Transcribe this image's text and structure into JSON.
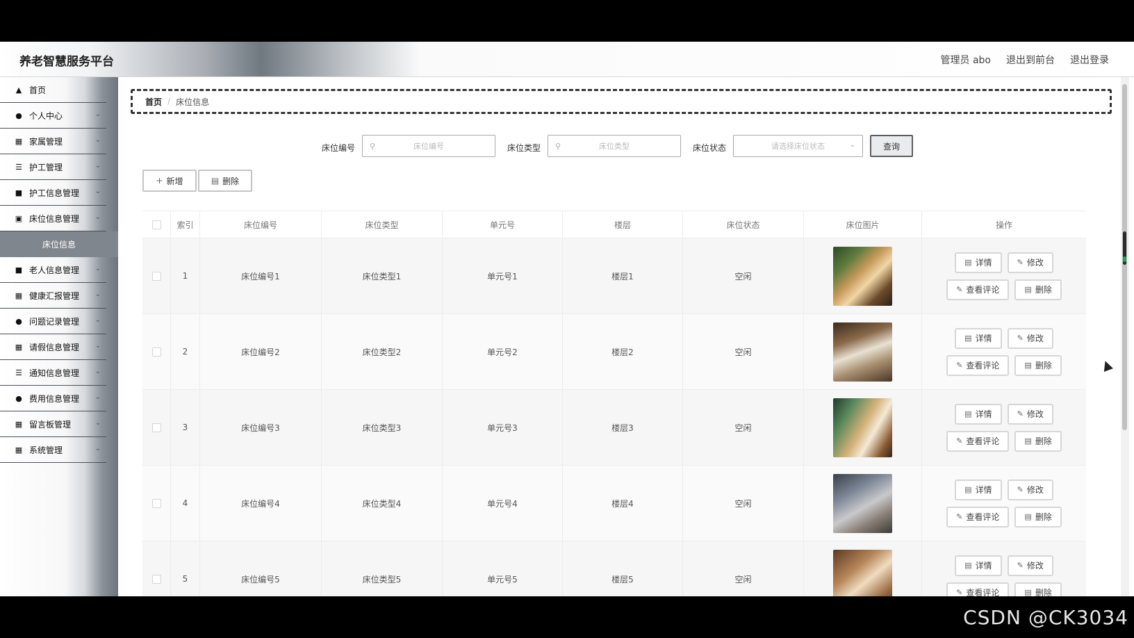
{
  "app": {
    "title": "养老智慧服务平台",
    "user": "管理员 abo",
    "back_front": "退出到前台",
    "logout": "退出登录"
  },
  "sidebar": {
    "items": [
      {
        "label": "首页",
        "icon": "home-icon"
      },
      {
        "label": "个人中心",
        "icon": "user-icon"
      },
      {
        "label": "家属管理",
        "icon": "calendar-icon"
      },
      {
        "label": "护工管理",
        "icon": "list-icon"
      },
      {
        "label": "护工信息管理",
        "icon": "monitor-icon"
      },
      {
        "label": "床位信息管理",
        "icon": "document-icon"
      },
      {
        "label": "老人信息管理",
        "icon": "monitor-icon"
      },
      {
        "label": "健康汇报管理",
        "icon": "grid-icon"
      },
      {
        "label": "问题记录管理",
        "icon": "user-icon"
      },
      {
        "label": "请假信息管理",
        "icon": "grid-icon"
      },
      {
        "label": "通知信息管理",
        "icon": "list-icon"
      },
      {
        "label": "费用信息管理",
        "icon": "user-icon"
      },
      {
        "label": "留言板管理",
        "icon": "grid-icon"
      },
      {
        "label": "系统管理",
        "icon": "grid-icon"
      }
    ],
    "active_sub": "床位信息"
  },
  "breadcrumb": {
    "home": "首页",
    "separator": "/",
    "current": "床位信息"
  },
  "search": {
    "bed_no_label": "床位编号",
    "bed_no_placeholder": "床位编号",
    "bed_type_label": "床位类型",
    "bed_type_placeholder": "床位类型",
    "bed_status_label": "床位状态",
    "bed_status_placeholder": "请选择床位状态",
    "query_button": "查询"
  },
  "toolbar": {
    "add_label": "新增",
    "delete_label": "删除"
  },
  "table": {
    "headers": [
      "索引",
      "床位编号",
      "床位类型",
      "单元号",
      "楼层",
      "床位状态",
      "床位图片",
      "操作"
    ],
    "rows": [
      {
        "index": "1",
        "bed_no": "床位编号1",
        "bed_type": "床位类型1",
        "unit": "单元号1",
        "floor": "楼层1",
        "status": "空闲"
      },
      {
        "index": "2",
        "bed_no": "床位编号2",
        "bed_type": "床位类型2",
        "unit": "单元号2",
        "floor": "楼层2",
        "status": "空闲"
      },
      {
        "index": "3",
        "bed_no": "床位编号3",
        "bed_type": "床位类型3",
        "unit": "单元号3",
        "floor": "楼层3",
        "status": "空闲"
      },
      {
        "index": "4",
        "bed_no": "床位编号4",
        "bed_type": "床位类型4",
        "unit": "单元号4",
        "floor": "楼层4",
        "status": "空闲"
      },
      {
        "index": "5",
        "bed_no": "床位编号5",
        "bed_type": "床位类型5",
        "unit": "单元号5",
        "floor": "楼层5",
        "status": "空闲"
      }
    ],
    "actions": {
      "detail": "详情",
      "edit": "修改",
      "comments": "查看评论",
      "delete": "删除"
    }
  },
  "watermark": "CSDN @CK3034"
}
